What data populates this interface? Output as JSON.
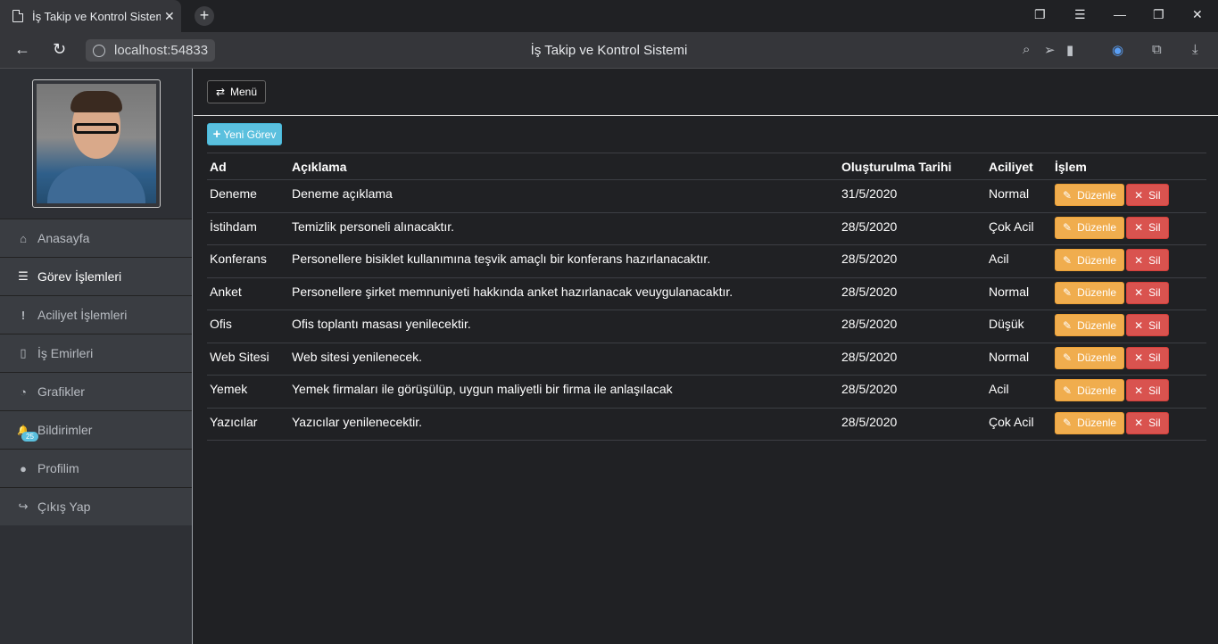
{
  "browser": {
    "tab_title": "İş Takip ve Kontrol Sistemi",
    "tab_close": "✕",
    "new_tab": "+",
    "url": "localhost:54833",
    "page_title": "İş Takip ve Kontrol Sistemi"
  },
  "sidebar": {
    "items": [
      {
        "label": "Anasayfa",
        "icon": "home-icon",
        "glyph": "⌂"
      },
      {
        "label": "Görev İşlemleri",
        "icon": "tasks-icon",
        "glyph": "☰"
      },
      {
        "label": "Aciliyet İşlemleri",
        "icon": "exclamation-icon",
        "glyph": "!"
      },
      {
        "label": "İş Emirleri",
        "icon": "document-icon",
        "glyph": "▯"
      },
      {
        "label": "Grafikler",
        "icon": "pie-chart-icon",
        "glyph": "◔"
      },
      {
        "label": "Bildirimler",
        "icon": "bell-icon",
        "glyph": "🔔"
      },
      {
        "label": "Profilim",
        "icon": "user-icon",
        "glyph": "●"
      },
      {
        "label": "Çıkış Yap",
        "icon": "sign-out-icon",
        "glyph": "↪"
      }
    ],
    "notification_count": "25"
  },
  "main": {
    "menu_label": "Menü",
    "new_task_label": "Yeni Görev",
    "columns": [
      "Ad",
      "Açıklama",
      "Oluşturulma Tarihi",
      "Aciliyet",
      "İşlem"
    ],
    "edit_label": "Düzenle",
    "delete_label": "Sil",
    "rows": [
      {
        "name": "Deneme",
        "desc": "Deneme açıklama",
        "date": "31/5/2020",
        "urgency": "Normal"
      },
      {
        "name": "İstihdam",
        "desc": "Temizlik personeli alınacaktır.",
        "date": "28/5/2020",
        "urgency": "Çok Acil"
      },
      {
        "name": "Konferans",
        "desc": "Personellere bisiklet kullanımına teşvik amaçlı bir konferans hazırlanacaktır.",
        "date": "28/5/2020",
        "urgency": "Acil"
      },
      {
        "name": "Anket",
        "desc": "Personellere şirket memnuniyeti hakkında anket hazırlanacak veuygulanacaktır.",
        "date": "28/5/2020",
        "urgency": "Normal"
      },
      {
        "name": "Ofis",
        "desc": "Ofis toplantı masası yenilecektir.",
        "date": "28/5/2020",
        "urgency": "Düşük"
      },
      {
        "name": "Web Sitesi",
        "desc": "Web sitesi yenilenecek.",
        "date": "28/5/2020",
        "urgency": "Normal"
      },
      {
        "name": "Yemek",
        "desc": "Yemek firmaları ile görüşülüp, uygun maliyetli bir firma ile anlaşılacak",
        "date": "28/5/2020",
        "urgency": "Acil"
      },
      {
        "name": "Yazıcılar",
        "desc": "Yazıcılar yenilenecektir.",
        "date": "28/5/2020",
        "urgency": "Çok Acil"
      }
    ]
  }
}
